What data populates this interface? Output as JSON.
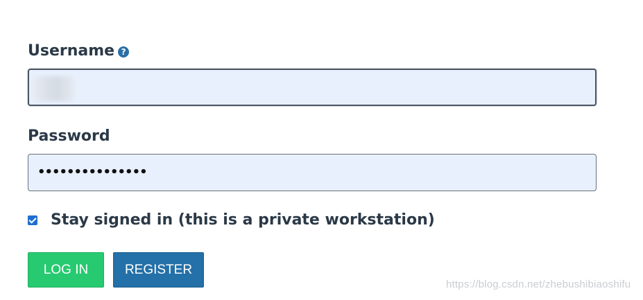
{
  "form": {
    "username_label": "Username",
    "help_icon_glyph": "?",
    "password_label": "Password",
    "password_mask": "•••••••••••••••",
    "stay_signed_in_label": "Stay signed in (this is a private workstation)",
    "stay_signed_in_checked": true,
    "login_button": "LOG IN",
    "register_button": "REGISTER"
  },
  "watermark": {
    "text": "https://blog.csdn.net/zhebushibiaoshifu"
  },
  "colors": {
    "label_text": "#2b3947",
    "field_background": "#e8f0fd",
    "help_icon": "#2a6fa6",
    "checkbox": "#1f6fd0",
    "login_button": "#27ca70",
    "register_button": "#2470a8"
  },
  "icons": {
    "help": "question-circle-icon",
    "checkbox": "checkmark-icon"
  }
}
